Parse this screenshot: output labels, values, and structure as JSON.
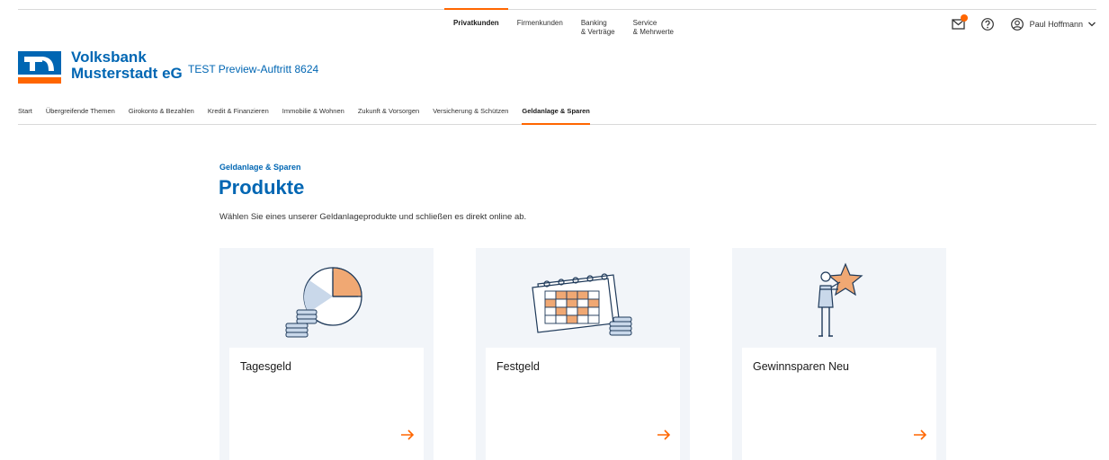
{
  "top_nav": [
    {
      "lines": [
        "Privatkunden"
      ],
      "active": true
    },
    {
      "lines": [
        "Firmenkunden"
      ],
      "active": false
    },
    {
      "lines": [
        "Banking",
        "& Verträge"
      ],
      "active": false
    },
    {
      "lines": [
        "Service",
        "& Mehrwerte"
      ],
      "active": false
    }
  ],
  "user": {
    "name": "Paul Hoffmann"
  },
  "bank": {
    "name_line1": "Volksbank",
    "name_line2": "Musterstadt eG",
    "preview_label": "TEST Preview-Auftritt 8624"
  },
  "sub_nav": [
    {
      "label": "Start",
      "active": false
    },
    {
      "label": "Übergreifende Themen",
      "active": false
    },
    {
      "label": "Girokonto & Bezahlen",
      "active": false
    },
    {
      "label": "Kredit & Finanzieren",
      "active": false
    },
    {
      "label": "Immobilie & Wohnen",
      "active": false
    },
    {
      "label": "Zukunft & Vorsorgen",
      "active": false
    },
    {
      "label": "Versicherung & Schützen",
      "active": false
    },
    {
      "label": "Geldanlage & Sparen",
      "active": true
    }
  ],
  "page": {
    "eyebrow": "Geldanlage & Sparen",
    "title": "Produkte",
    "lead": "Wählen Sie eines unserer Geldanlageprodukte und schließen es direkt online ab."
  },
  "cards": [
    {
      "title": "Tagesgeld",
      "icon": "clock-coins-illustration"
    },
    {
      "title": "Festgeld",
      "icon": "calendar-coins-illustration"
    },
    {
      "title": "Gewinnsparen Neu",
      "icon": "person-star-illustration"
    }
  ],
  "colors": {
    "brand_blue": "#0066b3",
    "accent_orange": "#ff6600",
    "card_bg": "#f2f5f9"
  }
}
